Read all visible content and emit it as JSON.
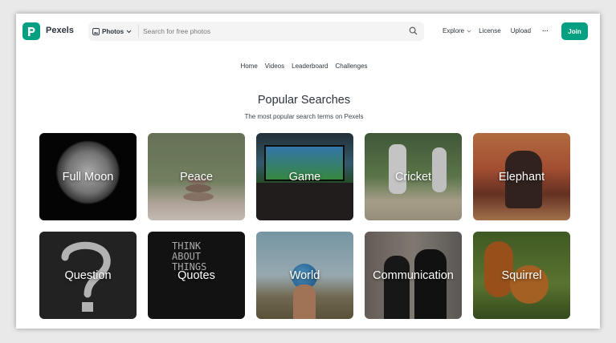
{
  "app": {
    "name": "Pexels"
  },
  "search": {
    "scope_label": "Photos",
    "placeholder": "Search for free photos"
  },
  "topnav": {
    "explore": "Explore",
    "license": "License",
    "upload": "Upload",
    "more": "···",
    "join": "Join"
  },
  "subnav": [
    "Home",
    "Videos",
    "Leaderboard",
    "Challenges"
  ],
  "section": {
    "title": "Popular Searches",
    "subtitle": "The most popular search terms on Pexels"
  },
  "tiles": [
    {
      "label": "Full Moon"
    },
    {
      "label": "Peace"
    },
    {
      "label": "Game"
    },
    {
      "label": "Cricket"
    },
    {
      "label": "Elephant"
    },
    {
      "label": "Question"
    },
    {
      "label": "Quotes"
    },
    {
      "label": "World"
    },
    {
      "label": "Communication"
    },
    {
      "label": "Squirrel"
    }
  ],
  "colors": {
    "brand": "#05a081",
    "text": "#2c343e"
  }
}
